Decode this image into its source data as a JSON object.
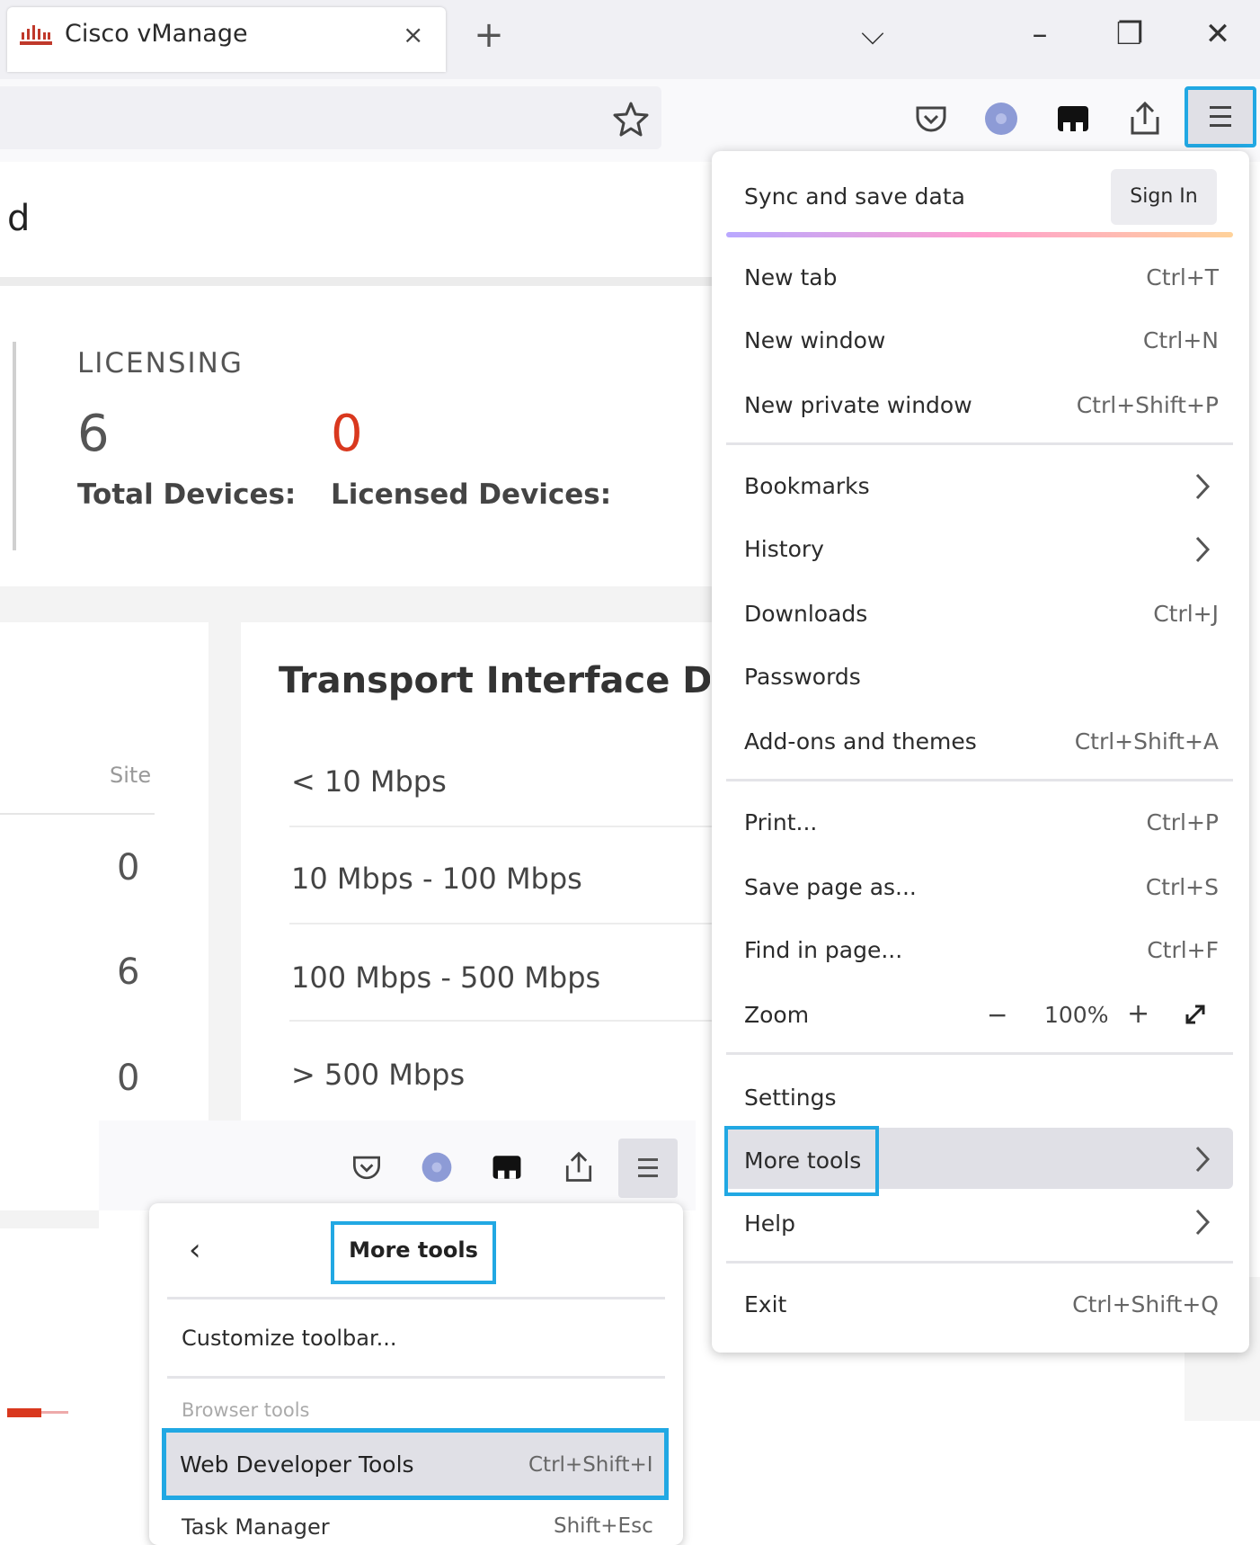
{
  "browser": {
    "tab_title": "Cisco vManage",
    "tab_close": "×",
    "new_tab": "+",
    "list_all_tabs": "⌵",
    "minimize": "–",
    "restore": "❐",
    "close_window": "✕",
    "accent_color": "#21a8e3"
  },
  "page": {
    "partial_title": "d",
    "licensing": {
      "heading": "LICENSING",
      "total_value": "6",
      "total_label": "Total Devices:",
      "licensed_value": "0",
      "licensed_label": "Licensed Devices:"
    },
    "site": {
      "header": "Site",
      "values": [
        "0",
        "6",
        "0"
      ]
    },
    "transport": {
      "title": "Transport Interface Distri",
      "rows": [
        "< 10 Mbps",
        "10 Mbps - 100 Mbps",
        "100 Mbps - 500 Mbps",
        "> 500 Mbps"
      ]
    }
  },
  "app_menu": {
    "sync_label": "Sync and save data",
    "sign_in": "Sign In",
    "items": [
      {
        "label": "New tab",
        "shortcut": "Ctrl+T"
      },
      {
        "label": "New window",
        "shortcut": "Ctrl+N"
      },
      {
        "label": "New private window",
        "shortcut": "Ctrl+Shift+P"
      },
      {
        "label": "Bookmarks",
        "shortcut": ""
      },
      {
        "label": "History",
        "shortcut": ""
      },
      {
        "label": "Downloads",
        "shortcut": "Ctrl+J"
      },
      {
        "label": "Passwords",
        "shortcut": ""
      },
      {
        "label": "Add-ons and themes",
        "shortcut": "Ctrl+Shift+A"
      },
      {
        "label": "Print...",
        "shortcut": "Ctrl+P"
      },
      {
        "label": "Save page as...",
        "shortcut": "Ctrl+S"
      },
      {
        "label": "Find in page...",
        "shortcut": "Ctrl+F"
      },
      {
        "label": "Zoom",
        "shortcut": ""
      },
      {
        "label": "Settings",
        "shortcut": ""
      },
      {
        "label": "More tools",
        "shortcut": ""
      },
      {
        "label": "Help",
        "shortcut": ""
      },
      {
        "label": "Exit",
        "shortcut": "Ctrl+Shift+Q"
      }
    ],
    "zoom": {
      "minus": "−",
      "level": "100%",
      "plus": "+"
    }
  },
  "more_tools_panel": {
    "back": "‹",
    "title": "More tools",
    "customize": "Customize toolbar...",
    "section_label": "Browser tools",
    "web_dev_label": "Web Developer Tools",
    "web_dev_shortcut": "Ctrl+Shift+I",
    "task_manager_label": "Task Manager",
    "task_manager_shortcut": "Shift+Esc"
  }
}
